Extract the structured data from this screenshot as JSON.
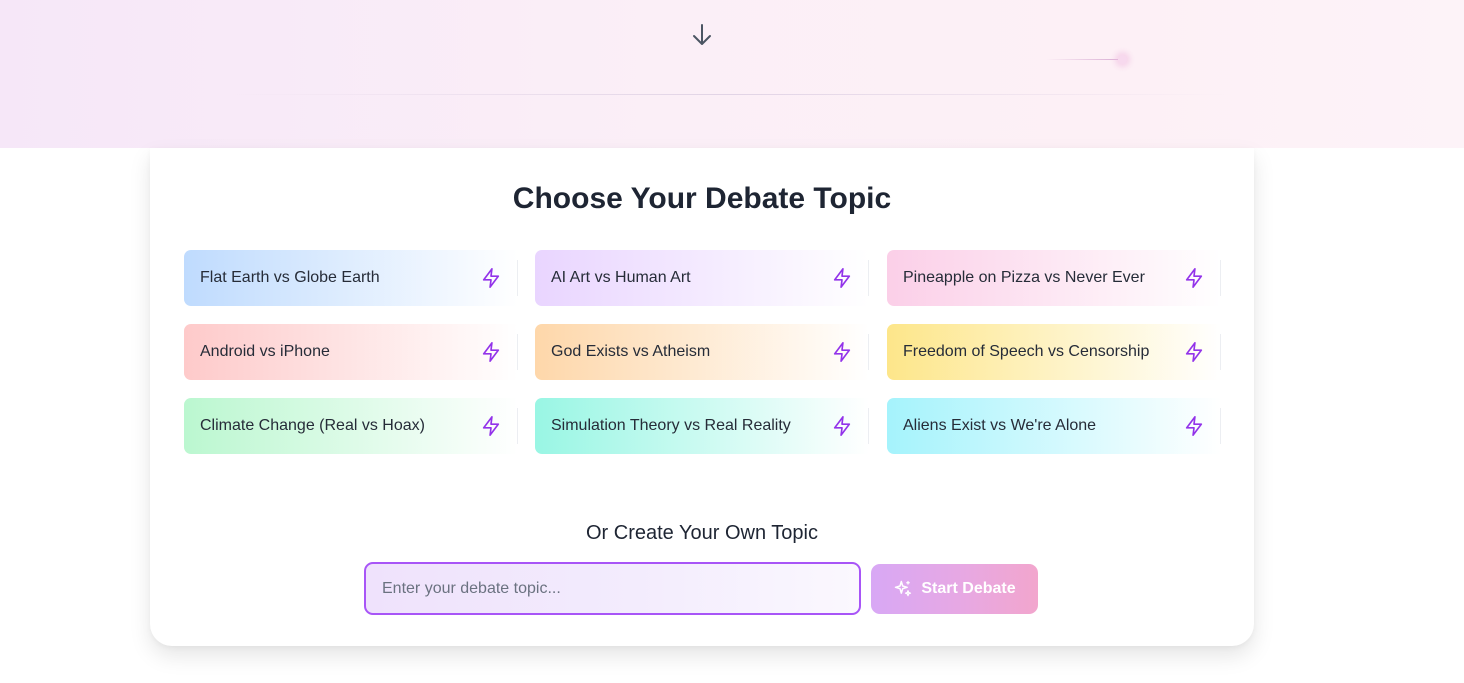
{
  "hero": {
    "scroll_icon": "arrow-down-icon"
  },
  "section": {
    "title": "Choose Your Debate Topic",
    "topics": [
      {
        "label": "Flat Earth vs Globe Earth",
        "gradient_from": "#bfdbfe",
        "gradient_to": "#ffffff",
        "icon": "lightning-icon"
      },
      {
        "label": "AI Art vs Human Art",
        "gradient_from": "#e9d5ff",
        "gradient_to": "#ffffff",
        "icon": "lightning-icon"
      },
      {
        "label": "Pineapple on Pizza vs Never Ever",
        "gradient_from": "#fbcfe8",
        "gradient_to": "#ffffff",
        "icon": "lightning-icon"
      },
      {
        "label": "Android vs iPhone",
        "gradient_from": "#fecaca",
        "gradient_to": "#ffffff",
        "icon": "lightning-icon"
      },
      {
        "label": "God Exists vs Atheism",
        "gradient_from": "#fed7aa",
        "gradient_to": "#ffffff",
        "icon": "lightning-icon"
      },
      {
        "label": "Freedom of Speech vs Censorship",
        "gradient_from": "#fde68a",
        "gradient_to": "#ffffff",
        "icon": "lightning-icon"
      },
      {
        "label": "Climate Change (Real vs Hoax)",
        "gradient_from": "#bbf7d0",
        "gradient_to": "#ffffff",
        "icon": "lightning-icon"
      },
      {
        "label": "Simulation Theory vs Real Reality",
        "gradient_from": "#99f6e4",
        "gradient_to": "#ffffff",
        "icon": "lightning-icon"
      },
      {
        "label": "Aliens Exist vs We're Alone",
        "gradient_from": "#a5f3fc",
        "gradient_to": "#ffffff",
        "icon": "lightning-icon"
      }
    ],
    "custom": {
      "title": "Or Create Your Own Topic",
      "placeholder": "Enter your debate topic...",
      "value": "",
      "button_label": "Start Debate",
      "button_icon": "sparkles-icon"
    }
  },
  "colors": {
    "accent": "#a855f7",
    "icon": "#9333ea",
    "title_text": "#1e2533"
  }
}
